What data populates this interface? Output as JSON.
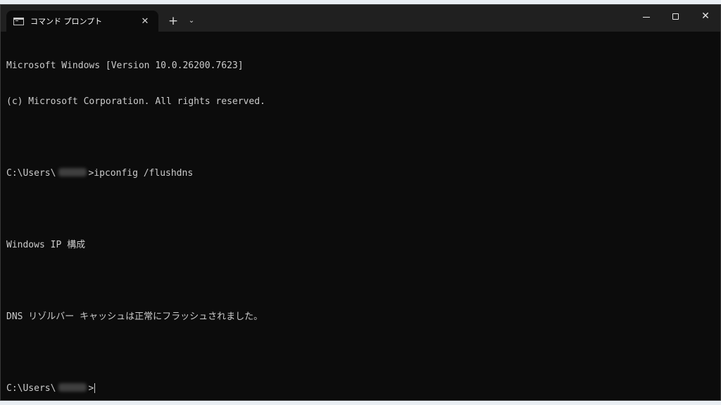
{
  "window": {
    "tab_title": "コマンド プロンプト",
    "tab_icon": "console-icon",
    "close_tab_glyph": "✕",
    "new_tab_glyph": "+",
    "dropdown_glyph": "⌄",
    "close_window_glyph": "✕"
  },
  "console": {
    "lines": [
      "Microsoft Windows [Version 10.0.26200.7623]",
      "(c) Microsoft Corporation. All rights reserved.",
      "",
      "",
      "",
      "Windows IP 構成",
      "",
      "DNS リゾルバー キャッシュは正常にフラッシュされました。",
      ""
    ],
    "prompt_prefix": "C:\\Users\\",
    "prompt_suffix": ">",
    "command": "ipconfig /flushdns"
  },
  "colors": {
    "background": "#0c0c0c",
    "titlebar": "#202020",
    "text": "#cccccc"
  }
}
